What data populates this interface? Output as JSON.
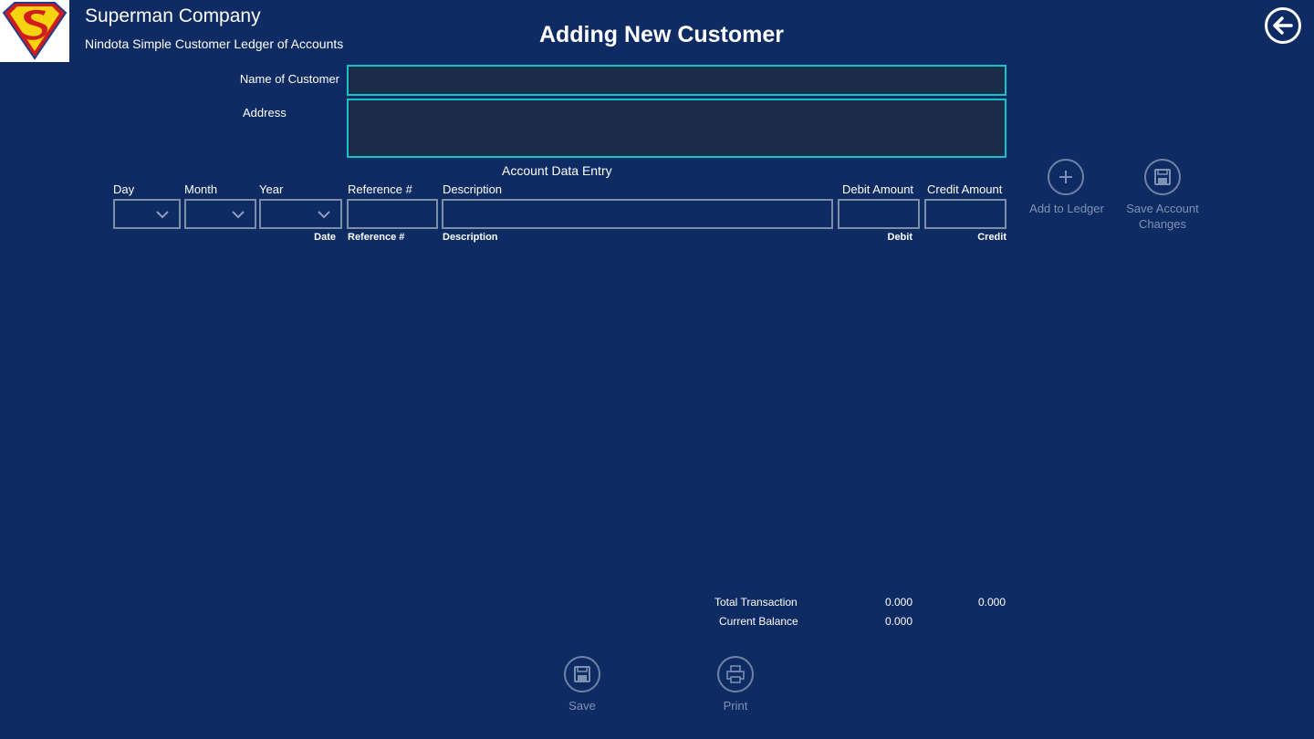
{
  "header": {
    "company": "Superman Company",
    "subtitle": "Nindota Simple Customer Ledger of Accounts",
    "title": "Adding New Customer"
  },
  "customer": {
    "name_label": "Name of Customer",
    "name_value": "",
    "address_label": "Address",
    "address_value": ""
  },
  "entry": {
    "section_title": "Account Data Entry",
    "day_label": "Day",
    "month_label": "Month",
    "year_label": "Year",
    "reference_label": "Reference #",
    "description_label": "Description",
    "debit_label": "Debit Amount",
    "credit_label": "Credit Amount",
    "col_date": "Date",
    "col_reference": "Reference #",
    "col_description": "Description",
    "col_debit": "Debit",
    "col_credit": "Credit"
  },
  "actions": {
    "add_to_ledger": "Add to Ledger",
    "save_account_line1": "Save Account",
    "save_account_line2": "Changes",
    "save": "Save",
    "print": "Print"
  },
  "summary": {
    "total_label": "Total Transaction",
    "total_debit": "0.000",
    "total_credit": "0.000",
    "balance_label": "Current Balance",
    "balance_value": "0.000"
  },
  "colors": {
    "background": "#0f2b63",
    "accent": "#17c2c8",
    "disabled": "#7f92b3"
  }
}
